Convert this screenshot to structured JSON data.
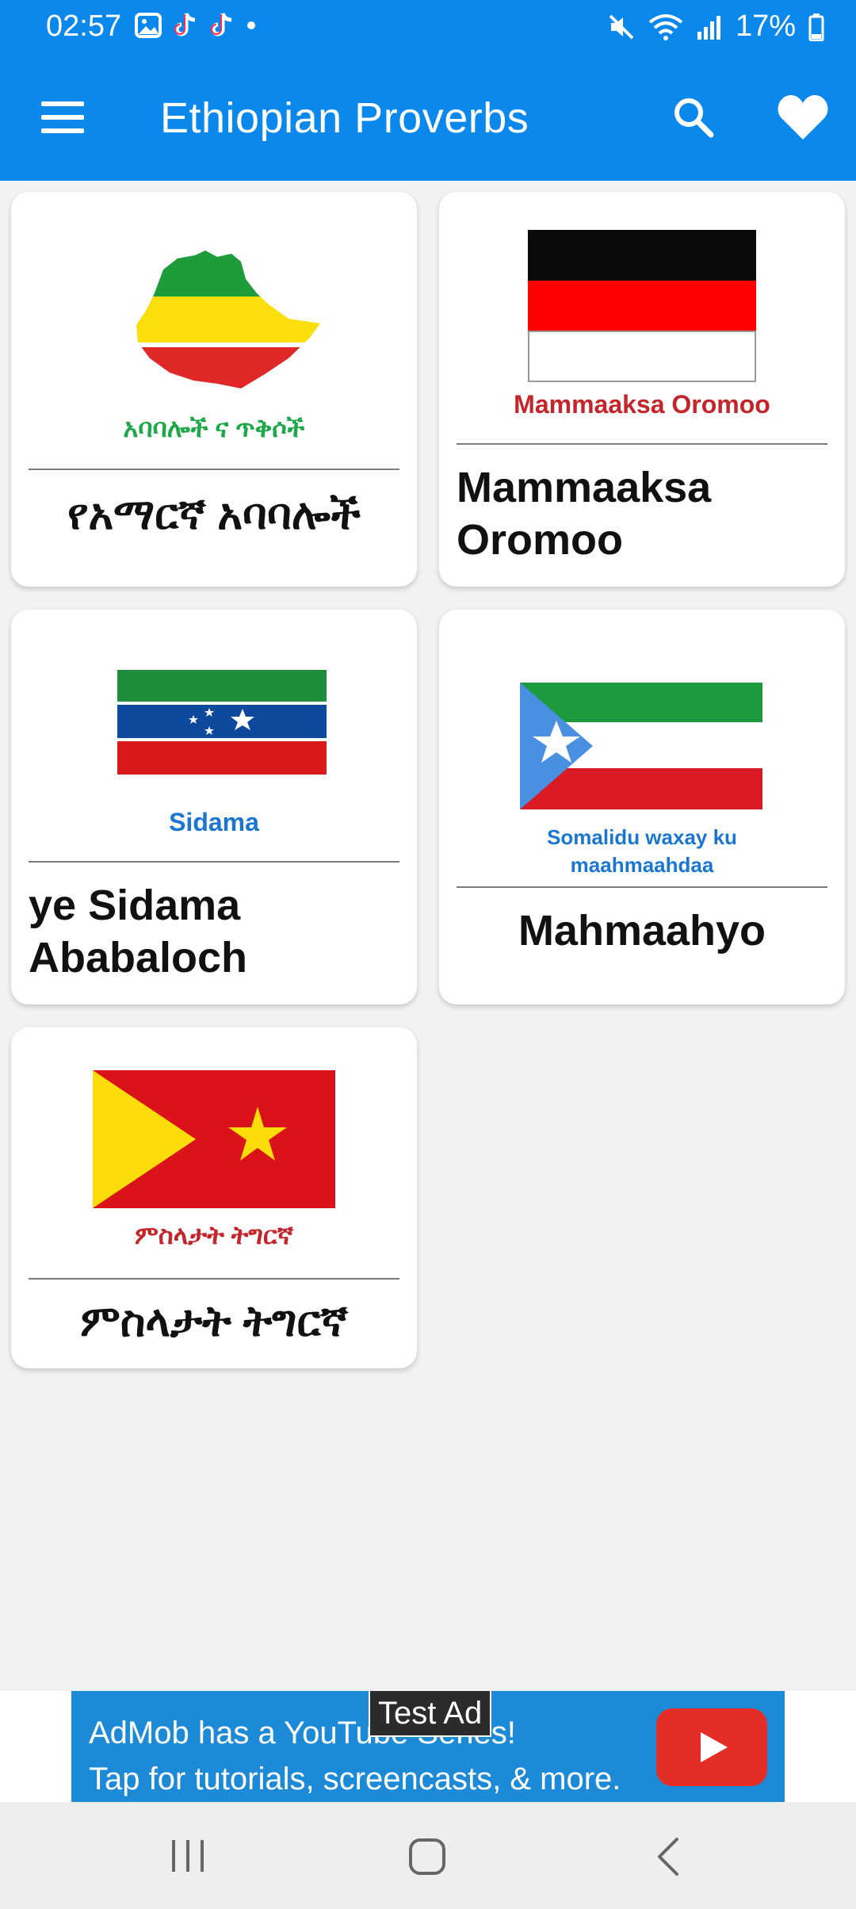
{
  "status_bar": {
    "time": "02:57",
    "battery": "17%",
    "icons": [
      "gallery-icon",
      "tiktok-icon",
      "tiktok-icon",
      "dot-icon",
      "mute-icon",
      "wifi-icon",
      "signal-icon",
      "battery-icon"
    ]
  },
  "app_bar": {
    "title": "Ethiopian Proverbs",
    "menu_icon": "hamburger-menu-icon",
    "search_icon": "search-icon",
    "favorite_icon": "heart-icon",
    "color": "#0A88EC"
  },
  "cards": [
    {
      "image_caption": "አባባሎች ና ጥቅሶች",
      "title": "የአማርኛ አባባሎች"
    },
    {
      "image_caption": "Mammaaksa Oromoo",
      "title": "Mammaaksa Oromoo"
    },
    {
      "image_caption": "Sidama",
      "title": "ye Sidama Ababaloch"
    },
    {
      "image_caption_line1": "Somalidu waxay ku",
      "image_caption_line2": "maahmaahdaa",
      "title": "Mahmaahyo"
    },
    {
      "image_caption": "ምስላታት ትግርኛ",
      "title": "ምስላታት ትግርኛ"
    }
  ],
  "ad": {
    "label": "Test Ad",
    "line1": "AdMob has a YouTube Series!",
    "line2": "Tap for tutorials, screencasts, & more."
  },
  "nav_bar": {
    "icons": [
      "recent-apps-icon",
      "home-icon",
      "back-icon"
    ]
  }
}
